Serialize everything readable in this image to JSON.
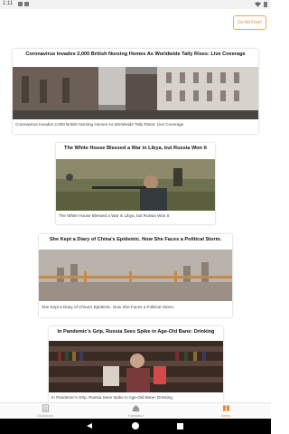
{
  "status_bar": {
    "time": "1:11"
  },
  "ad_free_button": "Go Ad Free!",
  "articles": [
    {
      "title": "Coronavirus Invades 2,000 British Nursing Homes As Worldwide Tally Rises: Live Coverage",
      "caption": "Coronavirus Invades 2,000 British Nursing Homes As Worldwide Tally Rises: Live Coverage"
    },
    {
      "title": "The White House Blessed a War in Libya, but Russia Won It",
      "caption": "The White House Blessed a War in Libya, but Russia Won It"
    },
    {
      "title": "She Kept a Diary of China's Epidemic. Now She Faces a Political Storm.",
      "caption": "She Kept a Diary of China's Epidemic. Now She Faces a Political Storm."
    },
    {
      "title": "In Pandemic's Grip, Russia Sees Spike in Age-Old Bane: Drinking",
      "caption": "In Pandemic's Grip, Russia Sees Spike in Age-Old Bane: Drinking"
    }
  ],
  "bottom_nav": [
    {
      "label": "Dictionary",
      "icon": "dictionary-icon"
    },
    {
      "label": "Translator",
      "icon": "translator-icon"
    },
    {
      "label": "News",
      "icon": "news-icon"
    }
  ]
}
